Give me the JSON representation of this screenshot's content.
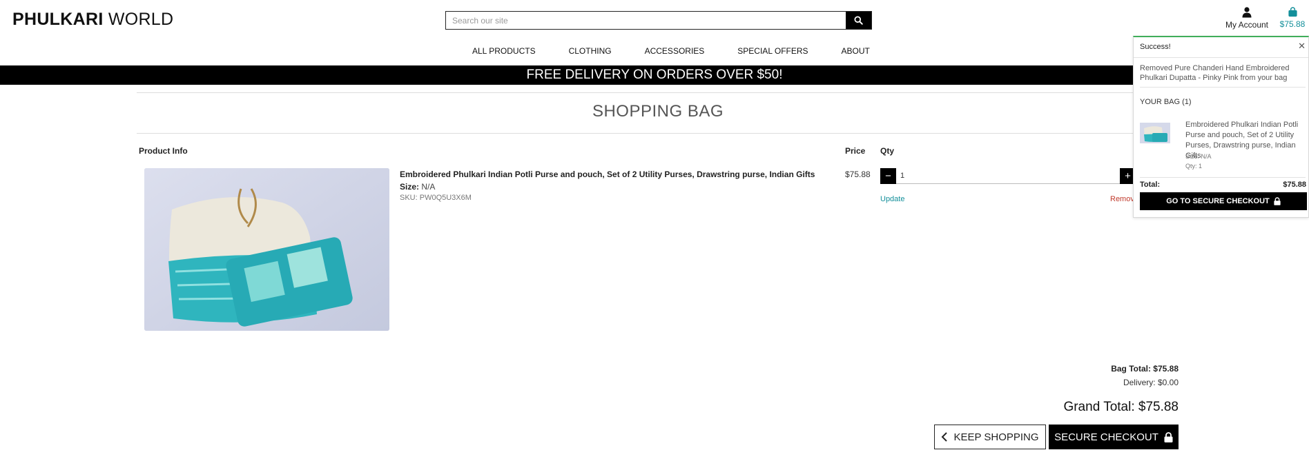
{
  "header": {
    "logo_bold": "PHULKARI",
    "logo_light": "WORLD",
    "search_placeholder": "Search our site",
    "account_label": "My Account",
    "bag_total": "$75.88"
  },
  "nav": [
    {
      "label": "ALL PRODUCTS"
    },
    {
      "label": "CLOTHING"
    },
    {
      "label": "ACCESSORIES"
    },
    {
      "label": "SPECIAL OFFERS"
    },
    {
      "label": "ABOUT"
    }
  ],
  "banner": "FREE DELIVERY ON ORDERS OVER $50!",
  "page_title": "SHOPPING BAG",
  "columns": {
    "product_info": "Product Info",
    "price": "Price",
    "qty": "Qty"
  },
  "item": {
    "name": "Embroidered Phulkari Indian Potli Purse and pouch, Set of 2 Utility Purses, Drawstring purse, Indian Gifts",
    "size_label": "Size:",
    "size_value": "N/A",
    "sku": "SKU: PW0Q5U3X6M",
    "price": "$75.88",
    "qty": "1",
    "update_label": "Update",
    "remove_label": "Remove"
  },
  "summary": {
    "bag_total": "Bag Total: $75.88",
    "delivery": "Delivery: $0.00",
    "grand_total": "Grand Total: $75.88",
    "keep_shopping": "KEEP SHOPPING",
    "secure_checkout": "SECURE CHECKOUT"
  },
  "toast": {
    "heading": "Success!",
    "message": "Removed Pure Chanderi Hand Embroidered Phulkari Dupatta - Pinky Pink from your bag",
    "your_bag": "YOUR BAG (1)",
    "item_name": "Embroidered Phulkari Indian Potli Purse and pouch, Set of 2 Utility Purses, Drawstring purse, Indian Gifts",
    "item_size": "Size: N/A",
    "item_qty": "Qty: 1",
    "total_label": "Total:",
    "total_value": "$75.88",
    "checkout_label": "GO TO SECURE CHECKOUT"
  },
  "colors": {
    "accent": "#138f9a",
    "remove": "#c0392b",
    "success": "#3fae5a"
  }
}
